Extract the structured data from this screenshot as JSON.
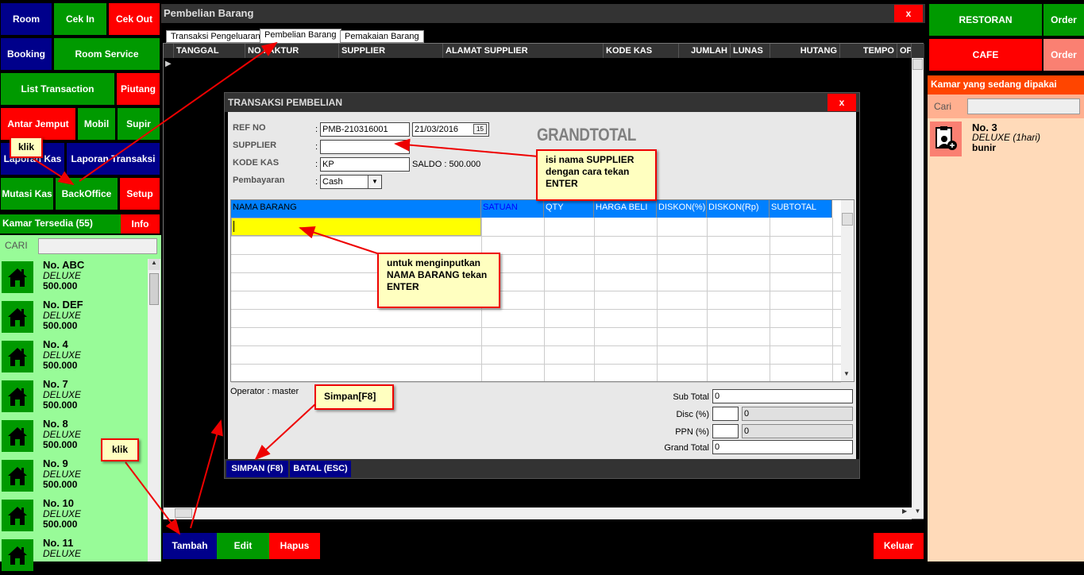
{
  "left": {
    "buttons": {
      "room": "Room",
      "cekin": "Cek In",
      "cekout": "Cek Out",
      "booking": "Booking",
      "roomservice": "Room Service",
      "listtrans": "List Transaction",
      "piutang": "Piutang",
      "antar": "Antar Jemput",
      "mobil": "Mobil",
      "supir": "Supir",
      "lapkas": "Laporan Kas",
      "laptrans": "Laporan Transaksi",
      "mutasi": "Mutasi Kas",
      "backoffice": "BackOffice",
      "setup": "Setup"
    },
    "kamar_header": "Kamar Tersedia (55)",
    "info": "Info",
    "cari": "CARI",
    "rooms": [
      {
        "name": "No. ABC",
        "type": "DELUXE",
        "price": "500.000"
      },
      {
        "name": "No. DEF",
        "type": "DELUXE",
        "price": "500.000"
      },
      {
        "name": "No. 4",
        "type": "DELUXE",
        "price": "500.000"
      },
      {
        "name": "No. 7",
        "type": "DELUXE",
        "price": "500.000"
      },
      {
        "name": "No. 8",
        "type": "DELUXE",
        "price": "500.000"
      },
      {
        "name": "No. 9",
        "type": "DELUXE",
        "price": "500.000"
      },
      {
        "name": "No. 10",
        "type": "DELUXE",
        "price": "500.000"
      },
      {
        "name": "No. 11",
        "type": "DELUXE",
        "price": ""
      }
    ]
  },
  "main": {
    "title": "Pembelian Barang",
    "close": "x",
    "tabs": [
      "Transaksi Pengeluaran",
      "Pembelian Barang",
      "Pemakaian Barang"
    ],
    "columns": [
      "TANGGAL",
      "NO FAKTUR",
      "SUPPLIER",
      "ALAMAT SUPPLIER",
      "KODE KAS",
      "JUMLAH",
      "LUNAS",
      "HUTANG",
      "TEMPO",
      "OP"
    ],
    "buttons": {
      "tambah": "Tambah",
      "edit": "Edit",
      "hapus": "Hapus",
      "keluar": "Keluar"
    }
  },
  "dialog": {
    "title": "TRANSAKSI PEMBELIAN",
    "close": "x",
    "labels": {
      "refno": "REF NO",
      "supplier": "SUPPLIER",
      "kodekas": "KODE KAS",
      "pembayaran": "Pembayaran"
    },
    "values": {
      "refno": "PMB-210316001",
      "date": "21/03/2016",
      "supplier": "",
      "kodekas": "KP",
      "saldo": "SALDO : 500.000",
      "pembayaran": "Cash"
    },
    "calendar_icon_text": "15",
    "grandtotal_label": "GRANDTOTAL",
    "grid_columns": [
      "NAMA BARANG",
      "SATUAN",
      "QTY",
      "HARGA BELI",
      "DISKON(%)",
      "DISKON(Rp)",
      "SUBTOTAL"
    ],
    "operator": "Operator : master",
    "totals": {
      "subtotal_label": "Sub Total",
      "subtotal": "0",
      "disc_label": "Disc (%)",
      "disc_pct": "",
      "disc_val": "0",
      "ppn_label": "PPN (%)",
      "ppn_pct": "",
      "ppn_val": "0",
      "grand_label": "Grand Total",
      "grand": "0"
    },
    "buttons": {
      "simpan": "SIMPAN (F8)",
      "batal": "BATAL (ESC)"
    }
  },
  "right": {
    "restoran": "RESTORAN",
    "order1": "Order",
    "cafe": "CAFE",
    "order2": "Order",
    "header": "Kamar yang sedang dipakai",
    "cari": "Cari",
    "room": {
      "name": "No. 3",
      "type": "DELUXE (1hari)",
      "guest": "bunir"
    }
  },
  "callouts": {
    "klik1": "klik",
    "klik2": "klik",
    "supplier": "isi nama SUPPLIER dengan cara tekan ENTER",
    "barang": "untuk menginputkan NAMA BARANG tekan ENTER",
    "simpan": "Simpan[F8]"
  },
  "colors": {
    "blue": "#00008b",
    "green": "#009a00",
    "red": "#ff0000",
    "lightgreen": "#98fb98",
    "peach": "#ffdab9",
    "header_blue": "#0080ff"
  }
}
